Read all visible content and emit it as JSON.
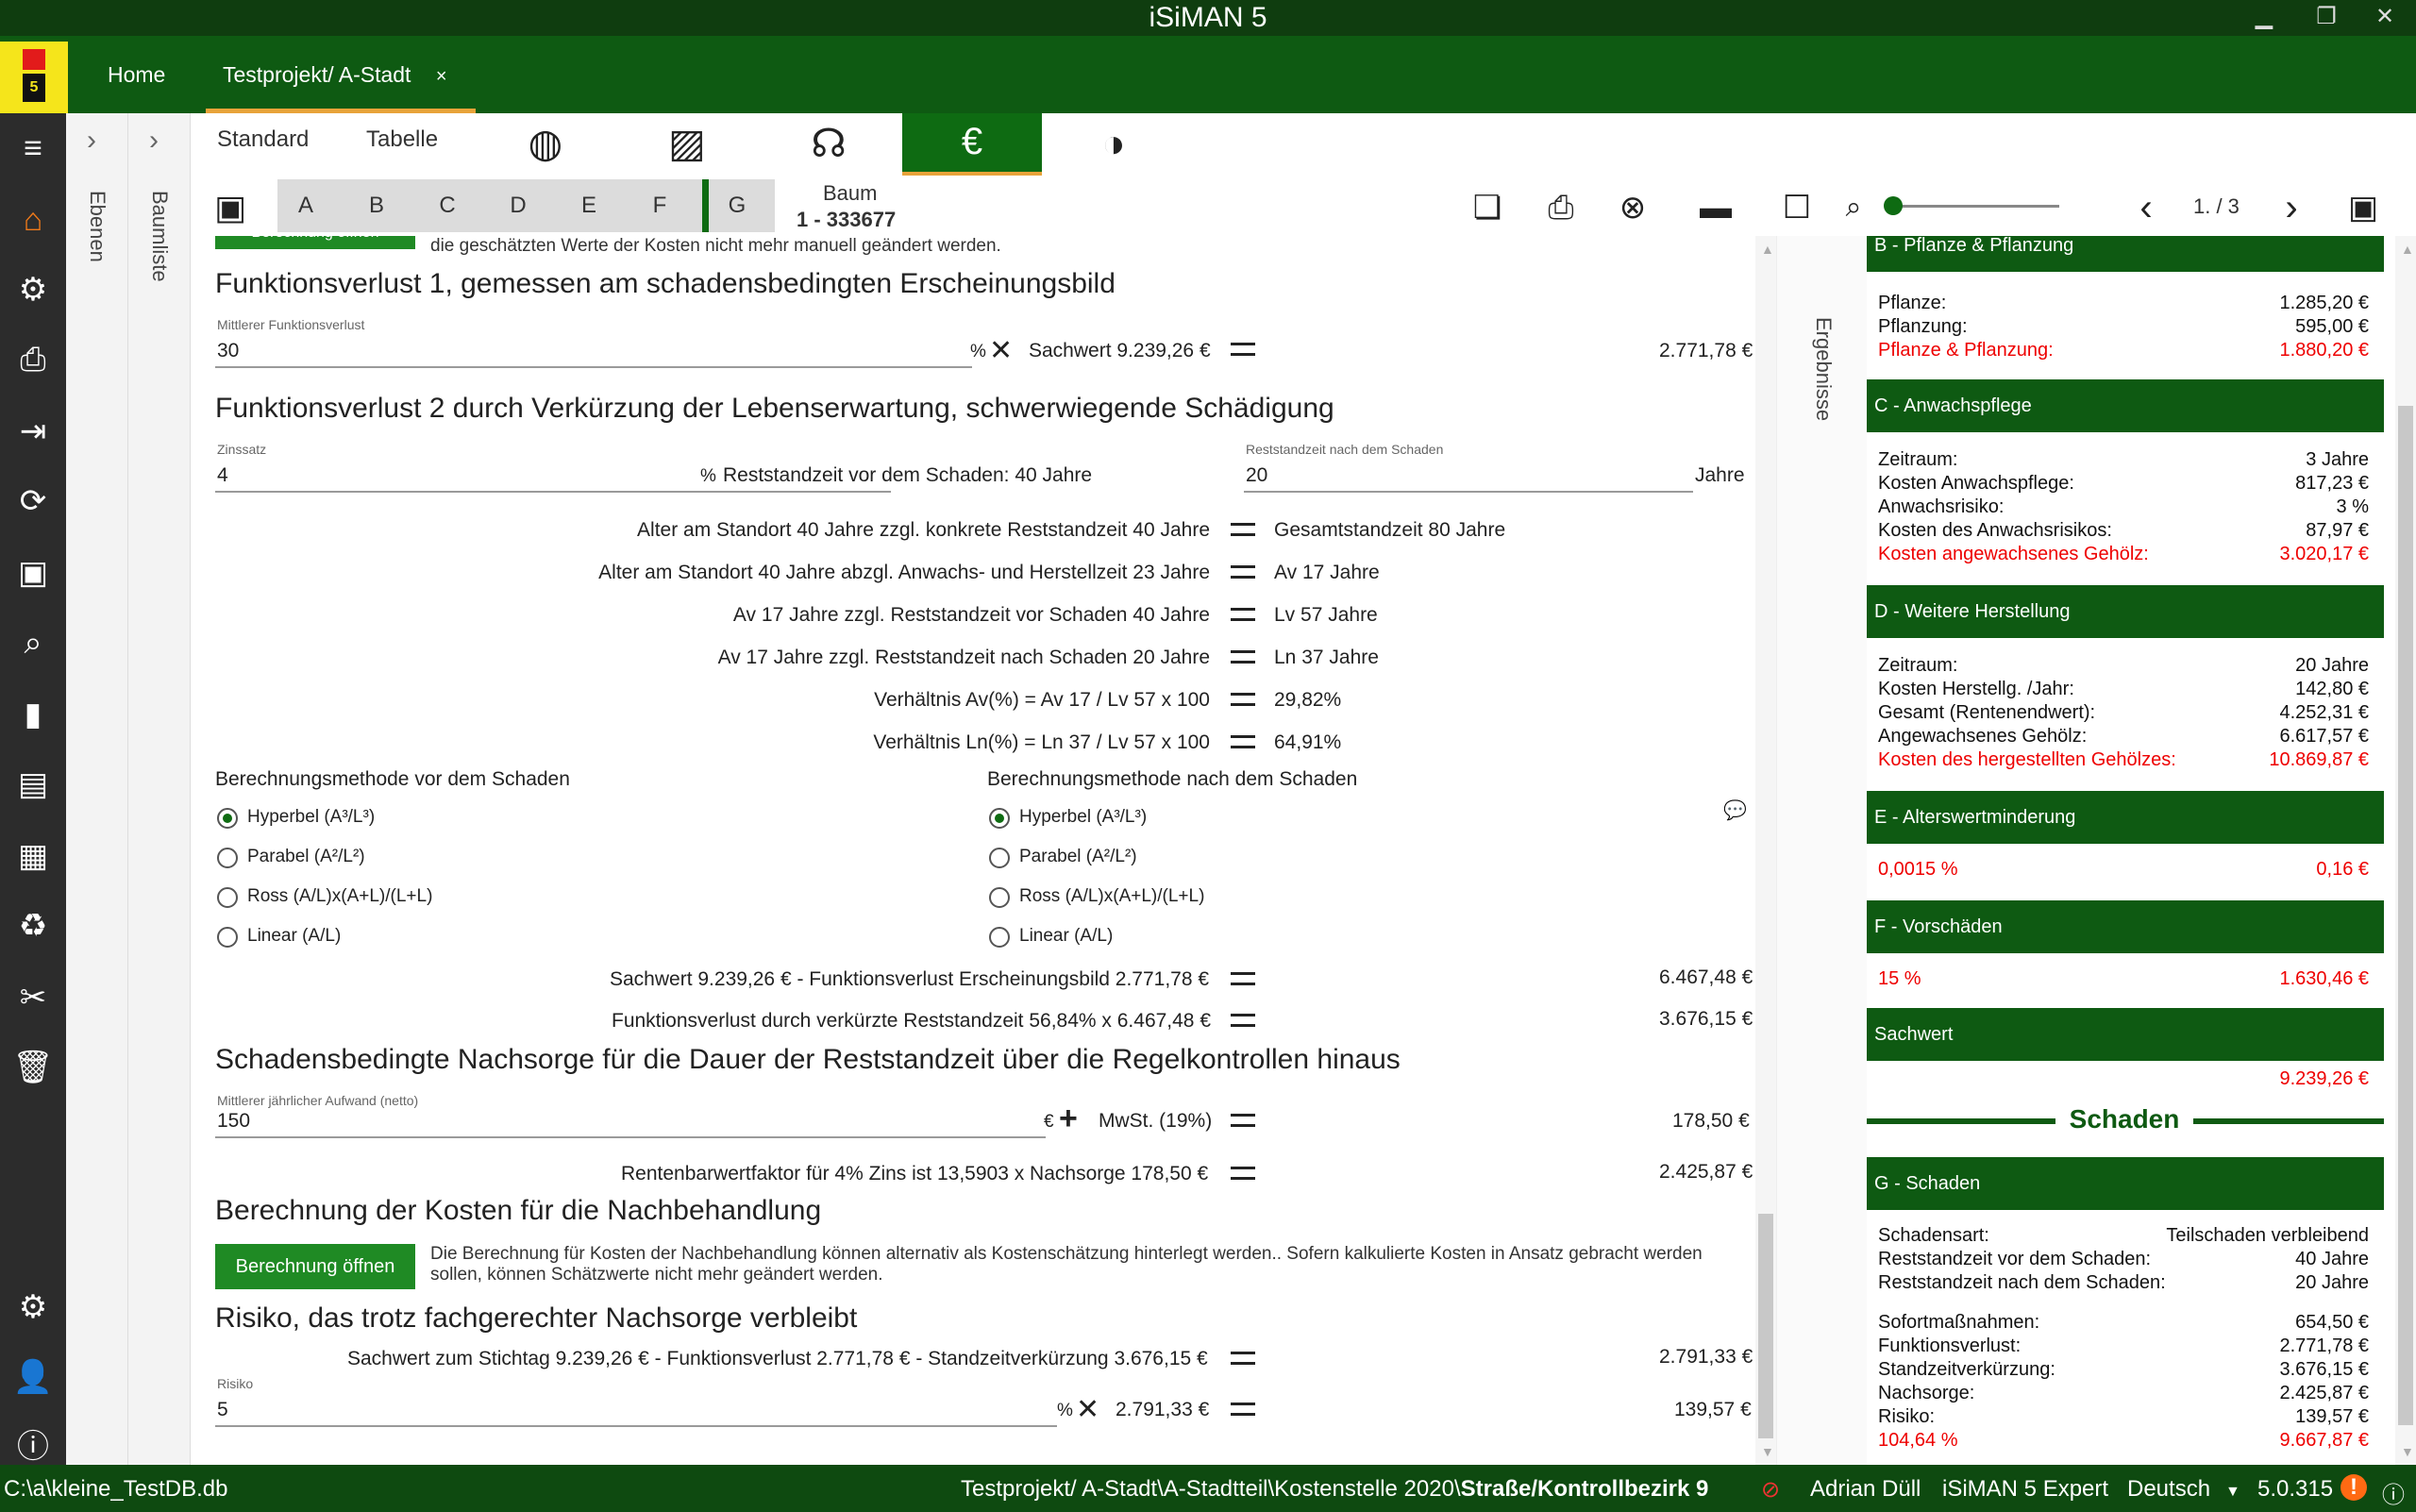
{
  "app": {
    "title": "iSiMAN 5"
  },
  "tabs": {
    "home": "Home",
    "project": "Testprojekt/ A-Stadt",
    "close": "×"
  },
  "strips": {
    "ebenen": "Ebenen",
    "baumliste": "Baumliste",
    "ergebnisse": "Ergebnisse"
  },
  "toolbar": {
    "standard": "Standard",
    "tabelle": "Tabelle",
    "letters": [
      "A",
      "B",
      "C",
      "D",
      "E",
      "F",
      "G"
    ],
    "baum_label": "Baum",
    "baum_id": "1 - 333677",
    "page": "1. / 3",
    "zoom_level": 0.0
  },
  "main": {
    "top_note": "die geschätzten Werte der Kosten nicht mehr manuell geändert werden.",
    "top_button": "Berechnung öffnen",
    "fv1": {
      "title": "Funktionsverlust 1, gemessen am schadensbedingten Erscheinungsbild",
      "field_label": "Mittlerer Funktionsverlust",
      "field_value": "30",
      "unit": "%",
      "times": "✕",
      "sachwert": "Sachwert 9.239,26 €",
      "result": "2.771,78 €"
    },
    "fv2": {
      "title": "Funktionsverlust 2 durch Verkürzung der Lebenserwartung, schwerwiegende Schädigung",
      "zins_label": "Zinssatz",
      "zins_value": "4",
      "zins_unit": "%",
      "rest_before": "Reststandzeit vor dem Schaden: 40 Jahre",
      "rest_after_label": "Reststandzeit nach dem Schaden",
      "rest_after_value": "20",
      "rest_after_unit": "Jahre",
      "rows": [
        {
          "left": "Alter am Standort 40 Jahre zzgl. konkrete Reststandzeit 40 Jahre",
          "right": "Gesamtstandzeit 80 Jahre"
        },
        {
          "left": "Alter am Standort 40 Jahre abzgl. Anwachs- und Herstellzeit 23 Jahre",
          "right": "Av 17 Jahre"
        },
        {
          "left": "Av 17 Jahre zzgl. Reststandzeit vor Schaden 40 Jahre",
          "right": "Lv 57 Jahre"
        },
        {
          "left": "Av 17 Jahre zzgl. Reststandzeit nach Schaden 20 Jahre",
          "right": "Ln 37 Jahre"
        },
        {
          "left": "Verhältnis Av(%) = Av 17 / Lv 57 x 100",
          "right": "29,82%"
        },
        {
          "left": "Verhältnis Ln(%) = Ln 37 / Lv 57 x 100",
          "right": "64,91%"
        }
      ],
      "method_before_title": "Berechnungsmethode vor dem Schaden",
      "method_after_title": "Berechnungsmethode nach dem Schaden",
      "methods": [
        "Hyperbel (A³/L³)",
        "Parabel (A²/L²)",
        "Ross (A/L)x(A+L)/(L+L)",
        "Linear (A/L)"
      ],
      "sum1_left": "Sachwert 9.239,26 € - Funktionsverlust Erscheinungsbild 2.771,78 €",
      "sum1_right": "6.467,48 €",
      "sum2_left": "Funktionsverlust durch verkürzte Reststandzeit 56,84% x 6.467,48 €",
      "sum2_right": "3.676,15 €"
    },
    "nachsorge": {
      "title": "Schadensbedingte Nachsorge für die Dauer der Reststandzeit über die Regelkontrollen hinaus",
      "field_label": "Mittlerer jährlicher Aufwand (netto)",
      "field_value": "150",
      "unit": "€",
      "plus": "+",
      "mwst": "MwSt. (19%)",
      "result": "178,50 €",
      "renten_left": "Rentenbarwertfaktor für 4% Zins ist 13,5903 x Nachsorge 178,50 €",
      "renten_right": "2.425,87 €"
    },
    "nachbehandlung": {
      "title": "Berechnung der Kosten für die Nachbehandlung",
      "button": "Berechnung öffnen",
      "note1": "Die Berechnung für Kosten der Nachbehandlung können alternativ als Kostenschätzung hinterlegt werden.. Sofern kalkulierte Kosten in Ansatz gebracht werden",
      "note2": "sollen, können Schätzwerte nicht mehr geändert werden."
    },
    "risiko": {
      "title": "Risiko, das trotz fachgerechter Nachsorge verbleibt",
      "calc_left": "Sachwert zum Stichtag 9.239,26 € - Funktionsverlust 2.771,78 € - Standzeitverkürzung 3.676,15 €",
      "calc_right": "2.791,33 €",
      "field_label": "Risiko",
      "field_value": "5",
      "unit": "%",
      "times": "✕",
      "base": "2.791,33 €",
      "result": "139,57 €"
    }
  },
  "results": {
    "b": {
      "title": "B - Pflanze & Pflanzung",
      "rows": [
        [
          "Pflanze:",
          "1.285,20 €"
        ],
        [
          "Pflanzung:",
          "595,00 €"
        ]
      ],
      "total": [
        "Pflanze & Pflanzung:",
        "1.880,20 €"
      ]
    },
    "c": {
      "title": "C - Anwachspflege",
      "rows": [
        [
          "Zeitraum:",
          "3 Jahre"
        ],
        [
          "Kosten Anwachspflege:",
          "817,23 €"
        ],
        [
          "Anwachsrisiko:",
          "3 %"
        ],
        [
          "Kosten des Anwachsrisikos:",
          "87,97 €"
        ]
      ],
      "total": [
        "Kosten angewachsenes Gehölz:",
        "3.020,17 €"
      ]
    },
    "d": {
      "title": "D - Weitere Herstellung",
      "rows": [
        [
          "Zeitraum:",
          "20 Jahre"
        ],
        [
          "Kosten Herstellg. /Jahr:",
          "142,80 €"
        ],
        [
          "Gesamt (Rentenendwert):",
          "4.252,31 €"
        ],
        [
          "Angewachsenes Gehölz:",
          "6.617,57 €"
        ]
      ],
      "total": [
        "Kosten des hergestellten Gehölzes:",
        "10.869,87 €"
      ]
    },
    "e": {
      "title": "E - Alterswertminderung",
      "total": [
        "0,0015 %",
        "0,16 €"
      ]
    },
    "f": {
      "title": "F - Vorschäden",
      "total": [
        "15 %",
        "1.630,46 €"
      ]
    },
    "sachwert": {
      "title": "Sachwert",
      "value": "9.239,26 €"
    },
    "schaden_divider": "Schaden",
    "g": {
      "title": "G - Schaden",
      "rows_a": [
        [
          "Schadensart:",
          "Teilschaden verbleibend"
        ],
        [
          "Reststandzeit vor dem Schaden:",
          "40 Jahre"
        ],
        [
          "Reststandzeit nach dem Schaden:",
          "20 Jahre"
        ]
      ],
      "rows_b": [
        [
          "Sofortmaßnahmen:",
          "654,50 €"
        ],
        [
          "Funktionsverlust:",
          "2.771,78 €"
        ],
        [
          "Standzeitverkürzung:",
          "3.676,15 €"
        ],
        [
          "Nachsorge:",
          "2.425,87 €"
        ],
        [
          "Risiko:",
          "139,57 €"
        ]
      ],
      "total": [
        "104,64 %",
        "9.667,87 €"
      ]
    }
  },
  "status": {
    "db": "C:\\a\\kleine_TestDB.db",
    "path": "Testprojekt/ A-Stadt\\A-Stadtteil\\Kostenstelle 2020\\",
    "path_bold": "Straße/Kontrollbezirk 9",
    "user": "Adrian Düll",
    "edition": "iSiMAN 5 Expert",
    "language": "Deutsch",
    "version": "5.0.315"
  },
  "colors": {
    "accent": "#0e6b12",
    "dark_green": "#0e5a12",
    "red": "#e00000",
    "orange": "#e8a33a"
  }
}
